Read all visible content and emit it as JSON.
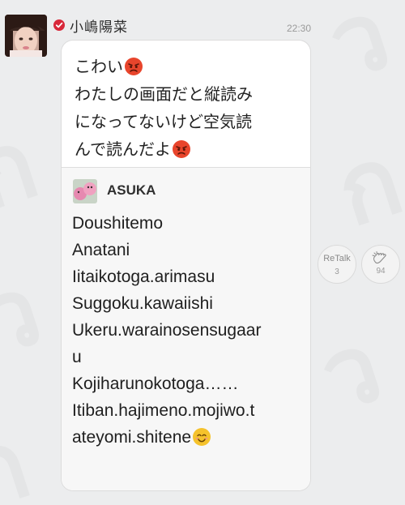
{
  "post": {
    "author": "小嶋陽菜",
    "verified_icon": "check-badge-icon",
    "time": "22:30",
    "message_lines": [
      "こわい",
      "わたしの画面だと縦読み",
      "になってないけど空気読",
      "んで読んだよ"
    ],
    "emoji": "angry-face-icon"
  },
  "quoted": {
    "author": "ASUKA",
    "lines": [
      "Doushitemo",
      "Anatani",
      "Iitaikotoga.arimasu",
      "Suggoku.kawaiishi",
      "Ukeru.warainosensugaar",
      "u",
      "Kojiharunokotoga……",
      "Itiban.hajimeno.mojiwo.t",
      "ateyomi.shitene"
    ],
    "emoji": "smiling-face-icon"
  },
  "actions": {
    "retalk_label": "ReTalk",
    "retalk_count": "3",
    "clap_icon": "clapping-hands-icon",
    "clap_count": "94"
  },
  "colors": {
    "background": "#ecedee",
    "verified": "#d8283a",
    "bubble": "#ffffff",
    "quote_bg": "#f7f7f7",
    "emoji_angry": "#e8452c",
    "emoji_smile": "#f5c22c"
  }
}
